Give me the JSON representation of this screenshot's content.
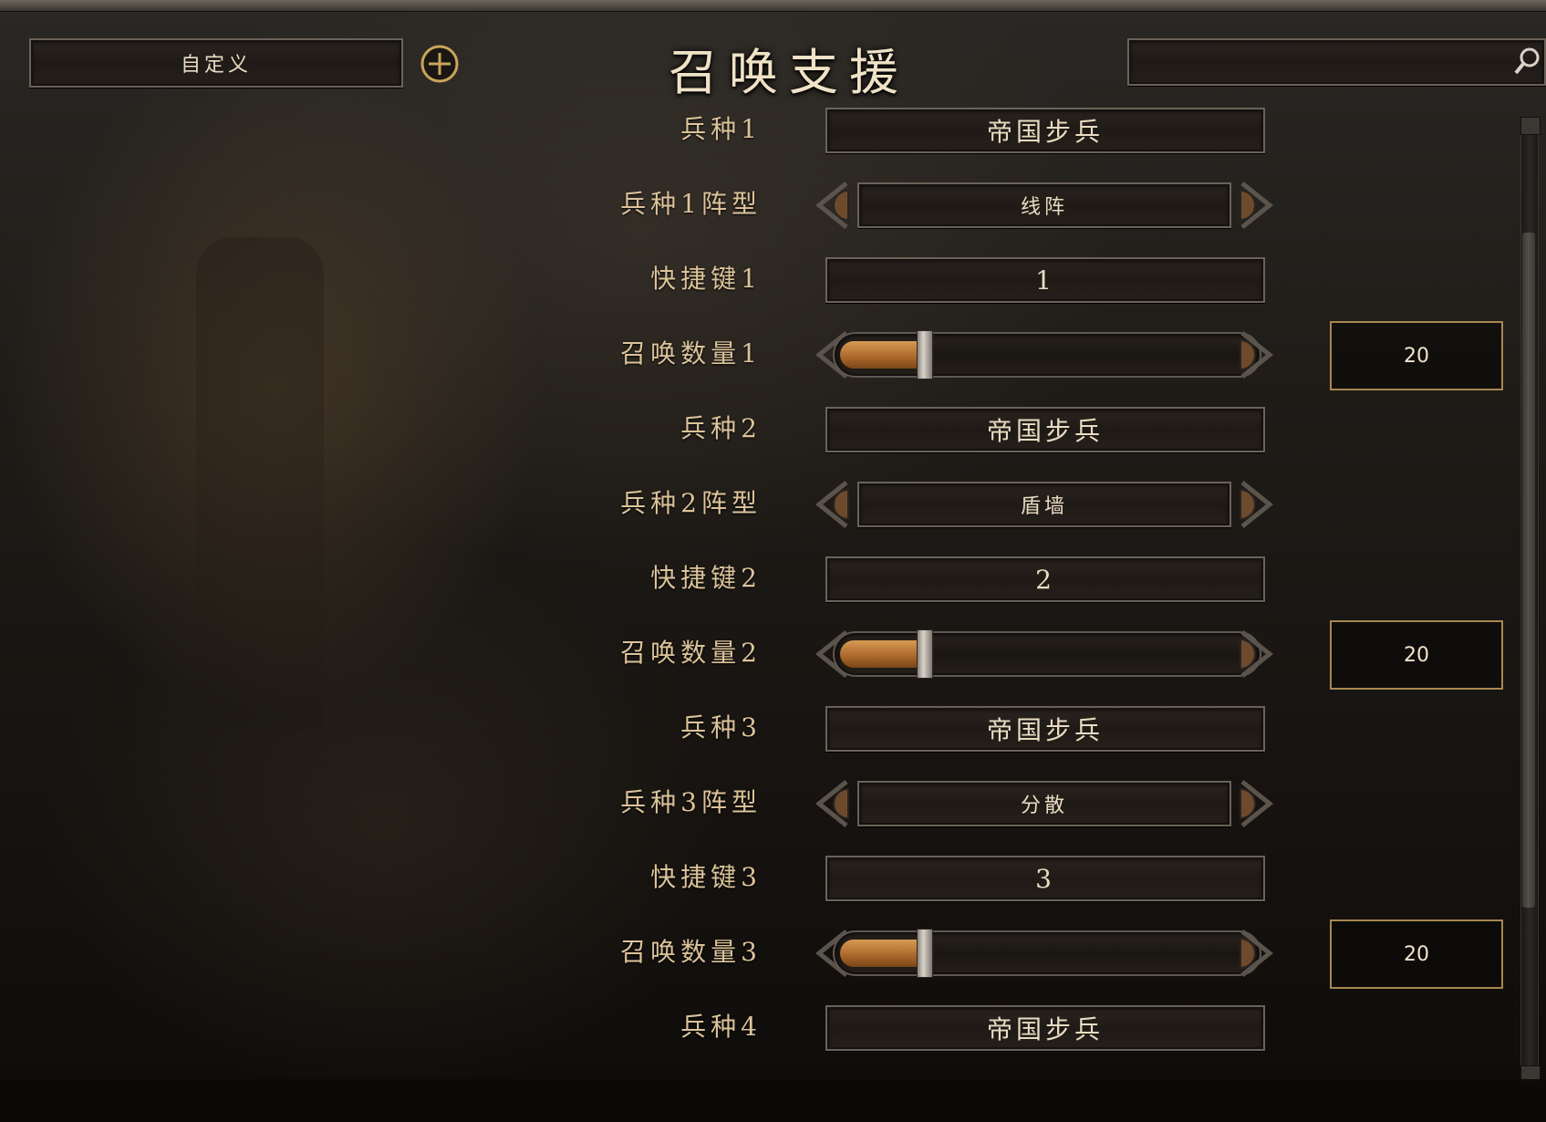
{
  "header": {
    "preset_label": "自定义",
    "title": "召唤支援",
    "search_value": ""
  },
  "rows": [
    {
      "label": "兵种1",
      "type": "select",
      "value": "帝国步兵"
    },
    {
      "label": "兵种1阵型",
      "type": "cycler",
      "value": "线阵"
    },
    {
      "label": "快捷键1",
      "type": "key",
      "value": "1"
    },
    {
      "label": "召唤数量1",
      "type": "slider",
      "value": "20",
      "fraction": 0.2
    },
    {
      "label": "兵种2",
      "type": "select",
      "value": "帝国步兵"
    },
    {
      "label": "兵种2阵型",
      "type": "cycler",
      "value": "盾墙"
    },
    {
      "label": "快捷键2",
      "type": "key",
      "value": "2"
    },
    {
      "label": "召唤数量2",
      "type": "slider",
      "value": "20",
      "fraction": 0.2
    },
    {
      "label": "兵种3",
      "type": "select",
      "value": "帝国步兵"
    },
    {
      "label": "兵种3阵型",
      "type": "cycler",
      "value": "分散"
    },
    {
      "label": "快捷键3",
      "type": "key",
      "value": "3"
    },
    {
      "label": "召唤数量3",
      "type": "slider",
      "value": "20",
      "fraction": 0.2
    },
    {
      "label": "兵种4",
      "type": "select",
      "value": "帝国步兵"
    }
  ],
  "colors": {
    "label": "#dcc39a",
    "accent_fill": "#c27a3a",
    "number_box_border": "#a88750"
  }
}
